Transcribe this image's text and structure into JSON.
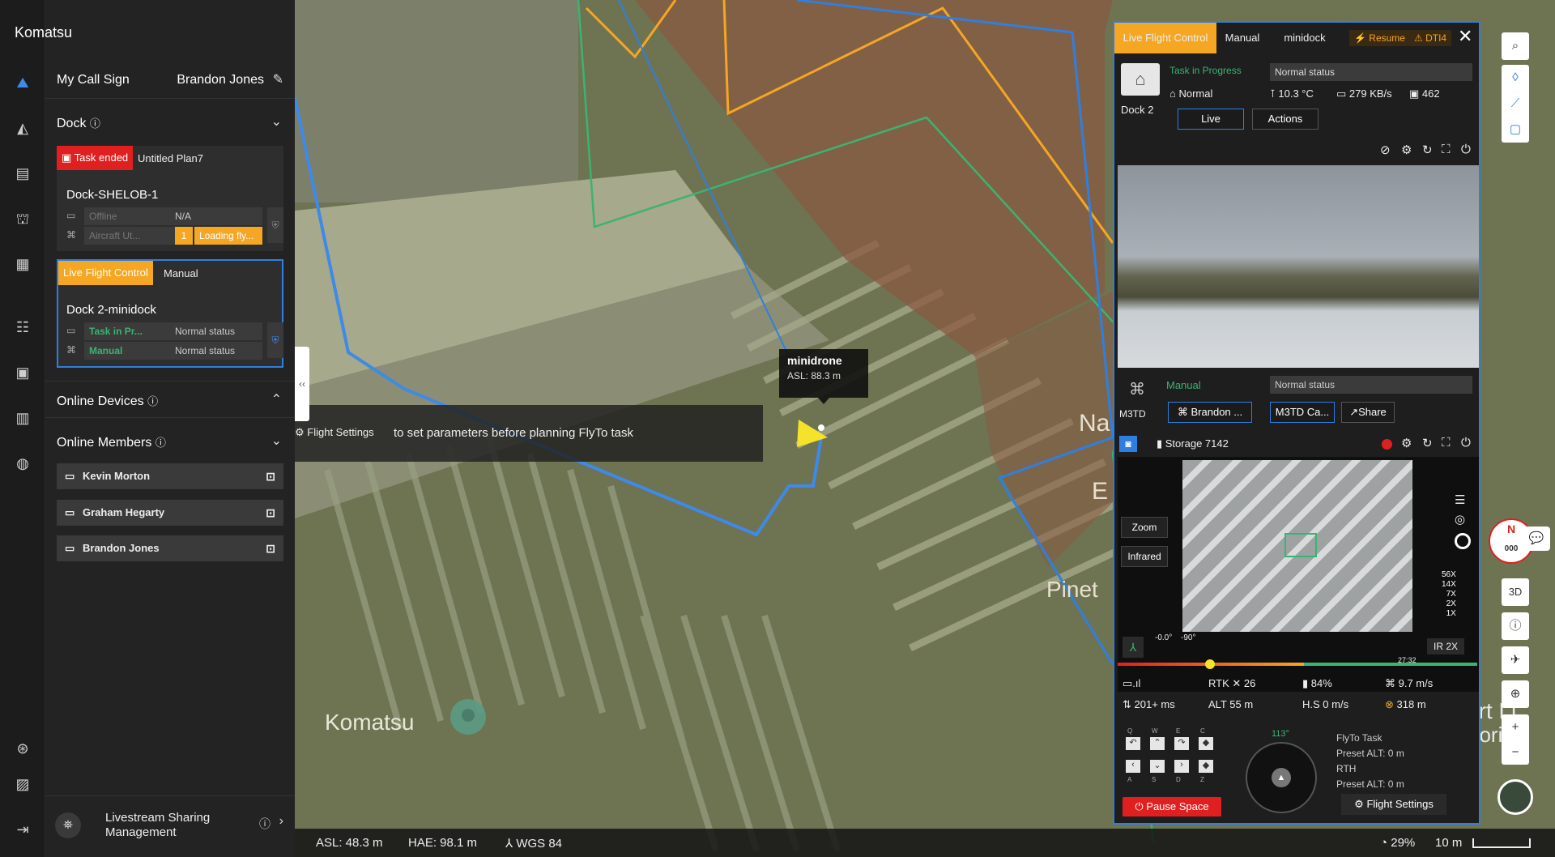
{
  "app": {
    "title": "Komatsu"
  },
  "panel": {
    "call_sign_label": "My Call Sign",
    "call_sign_value": "Brandon Jones",
    "dock_section": "Dock",
    "dock1": {
      "status_tag": "Task ended",
      "plan": "Untitled Plan7",
      "name": "Dock-SHELOB-1",
      "dock_state": "Offline",
      "dock_state_value": "N/A",
      "aircraft_state": "Aircraft Ut...",
      "aircraft_count": "1",
      "aircraft_value": "Loading fly..."
    },
    "dock2": {
      "status_tag": "Live Flight Control",
      "mode_tag": "Manual",
      "name": "Dock 2-minidock",
      "dock_state": "Task in Pr...",
      "dock_state_value": "Normal status",
      "aircraft_state": "Manual",
      "aircraft_value": "Normal status"
    },
    "online_devices": "Online Devices",
    "online_members": "Online Members",
    "members": [
      "Kevin Morton",
      "Graham Hegarty",
      "Brandon Jones"
    ],
    "livestream": "Livestream Sharing Management"
  },
  "map": {
    "drone_label": "minidrone",
    "drone_alt": "ASL: 88.3 m",
    "hint_button": "Flight Settings",
    "hint_text": "to set parameters before planning FlyTo task",
    "place_label": "Komatsu",
    "place_na": "Na",
    "place_e": "E",
    "place_pine": "Pinet",
    "place_right1": "ort Li",
    "place_right2": "oorily"
  },
  "bottom": {
    "asl": "ASL: 48.3 m",
    "hae": "HAE: 98.1 m",
    "datum": "WGS 84",
    "zoom_pct": "29%",
    "scale": "10 m"
  },
  "lfp": {
    "tabs": [
      "Live Flight Control",
      "Manual",
      "minidock"
    ],
    "resume": "Resume",
    "dti": "DTI4",
    "dock_name": "Dock 2",
    "task_status": "Task in Progress",
    "dock_normal": "Normal status",
    "normal": "Normal",
    "temp": "10.3 °C",
    "net": "279 KB/s",
    "count": "462",
    "live_btn": "Live",
    "actions_btn": "Actions",
    "aircraft_mode": "Manual",
    "aircraft_status": "Normal status",
    "aircraft_model": "M3TD",
    "pilot_btn": "Brandon ...",
    "camera_btn": "M3TD Ca...",
    "share_btn": "Share",
    "storage": "Storage 7142",
    "zoom_btn": "Zoom",
    "infrared_btn": "Infrared",
    "zoom_levels": [
      "56X",
      "14X",
      "7X",
      "2X",
      "1X"
    ],
    "gimbal_pitch": "-0.0°",
    "gimbal_yaw": "-90°",
    "ir_zoom": "IR 2X",
    "time_end": "27:32",
    "rtk": "RTK",
    "rtk_count": "26",
    "battery": "84%",
    "speed": "9.7 m/s",
    "latency": "201+ ms",
    "alt": "ALT 55 m",
    "hs": "H.S 0 m/s",
    "distance": "318 m",
    "keys": [
      "Q",
      "W",
      "E",
      "C",
      "A",
      "S",
      "D",
      "Z"
    ],
    "heading": "113°",
    "flyto_title": "FlyTo Task",
    "preset1": "Preset ALT: 0 m",
    "rth": "RTH",
    "preset2": "Preset ALT: 0 m",
    "flight_settings": "Flight Settings",
    "pause": "Pause Space"
  },
  "colors": {
    "accent": "#2f7fe0",
    "warning": "#f5a623",
    "danger": "#e02020",
    "ok": "#3cb371"
  }
}
